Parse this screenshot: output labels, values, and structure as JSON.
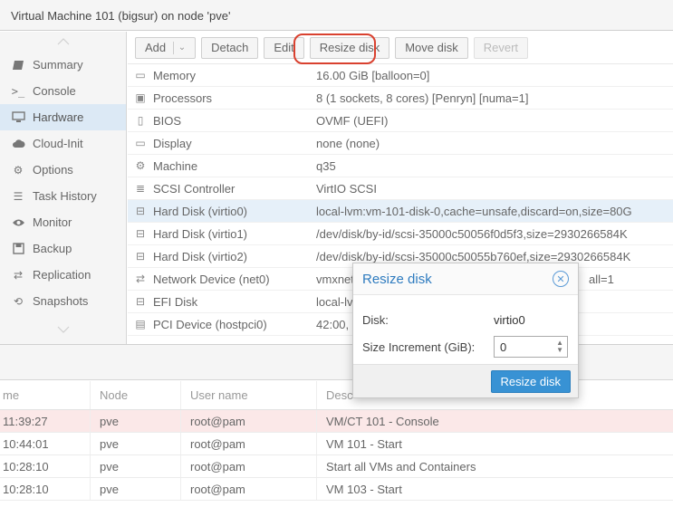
{
  "window": {
    "title": "Virtual Machine 101 (bigsur) on node 'pve'"
  },
  "sidebar": {
    "items": [
      {
        "label": "Summary",
        "icon": "summary-icon"
      },
      {
        "label": "Console",
        "icon": "console-icon"
      },
      {
        "label": "Hardware",
        "icon": "monitor-icon",
        "active": true
      },
      {
        "label": "Cloud-Init",
        "icon": "cloud-icon"
      },
      {
        "label": "Options",
        "icon": "gear-icon"
      },
      {
        "label": "Task History",
        "icon": "list-icon"
      },
      {
        "label": "Monitor",
        "icon": "eye-icon"
      },
      {
        "label": "Backup",
        "icon": "floppy-icon"
      },
      {
        "label": "Replication",
        "icon": "retweet-icon"
      },
      {
        "label": "Snapshots",
        "icon": "history-icon"
      }
    ]
  },
  "toolbar": {
    "add": "Add",
    "detach": "Detach",
    "edit": "Edit",
    "resize": "Resize disk",
    "move": "Move disk",
    "revert": "Revert"
  },
  "hardware": [
    {
      "name": "Memory",
      "value": "16.00 GiB [balloon=0]"
    },
    {
      "name": "Processors",
      "value": "8 (1 sockets, 8 cores) [Penryn] [numa=1]"
    },
    {
      "name": "BIOS",
      "value": "OVMF (UEFI)"
    },
    {
      "name": "Display",
      "value": "none (none)"
    },
    {
      "name": "Machine",
      "value": "q35"
    },
    {
      "name": "SCSI Controller",
      "value": "VirtIO SCSI"
    },
    {
      "name": "Hard Disk (virtio0)",
      "value": "local-lvm:vm-101-disk-0,cache=unsafe,discard=on,size=80G"
    },
    {
      "name": "Hard Disk (virtio1)",
      "value": "/dev/disk/by-id/scsi-35000c50056f0d5f3,size=2930266584K"
    },
    {
      "name": "Hard Disk (virtio2)",
      "value": "/dev/disk/by-id/scsi-35000c50055b760ef,size=2930266584K"
    },
    {
      "name": "Network Device (net0)",
      "value": "vmxnet3=",
      "value_right": "all=1"
    },
    {
      "name": "EFI Disk",
      "value": "local-lv"
    },
    {
      "name": "PCI Device (hostpci0)",
      "value": "42:00,"
    }
  ],
  "tasks": {
    "headers": {
      "time": "me",
      "node": "Node",
      "user": "User name",
      "desc": "Desc"
    },
    "rows": [
      {
        "time": "11:39:27",
        "node": "pve",
        "user": "root@pam",
        "desc": "VM/CT 101 - Console",
        "error": true
      },
      {
        "time": "10:44:01",
        "node": "pve",
        "user": "root@pam",
        "desc": "VM 101 - Start"
      },
      {
        "time": "10:28:10",
        "node": "pve",
        "user": "root@pam",
        "desc": "Start all VMs and Containers"
      },
      {
        "time": "10:28:10",
        "node": "pve",
        "user": "root@pam",
        "desc": "VM 103 - Start"
      }
    ]
  },
  "dialog": {
    "title": "Resize disk",
    "disk_label": "Disk:",
    "disk_value": "virtio0",
    "increment_label": "Size Increment (GiB):",
    "increment_value": "0",
    "submit": "Resize disk"
  },
  "colors": {
    "accent": "#3892d4",
    "highlight": "#d9412f",
    "selected_row": "#e6f0f9",
    "error_row": "#fbe8e8"
  }
}
